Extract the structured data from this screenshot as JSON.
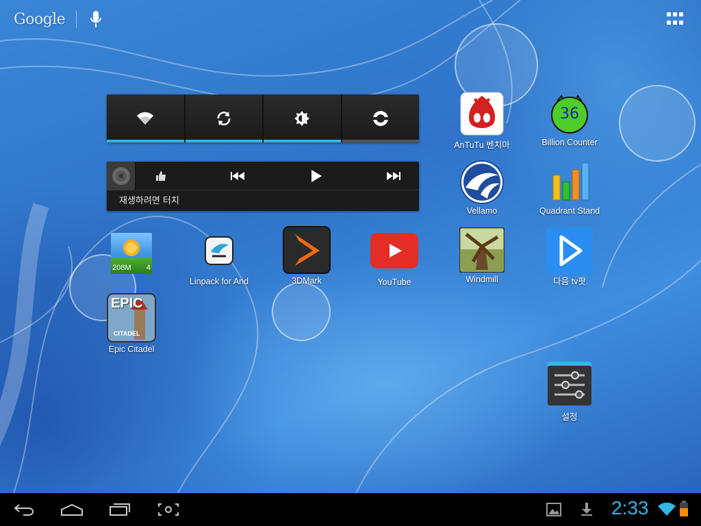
{
  "search": {
    "logo_text": "Google",
    "icons": [
      "mic-icon"
    ]
  },
  "launcher": {
    "all_apps_icon": "all-apps-grid-icon"
  },
  "power_widget": {
    "buttons": [
      {
        "name": "wifi",
        "icon": "wifi-icon",
        "state": "on"
      },
      {
        "name": "sync",
        "icon": "sync-icon",
        "state": "on"
      },
      {
        "name": "brightness",
        "icon": "brightness-icon",
        "state": "on"
      },
      {
        "name": "rotation",
        "icon": "rotation-icon",
        "state": "off"
      }
    ]
  },
  "music_widget": {
    "status_text": "재생하려면 터치",
    "controls": [
      "thumbs-up-icon",
      "previous-icon",
      "play-icon",
      "next-icon"
    ]
  },
  "apps": {
    "antutu": "AnTuTu 벤치마",
    "billion_counter": "Billion Counter",
    "billion_counter_badge": "36",
    "vellamo": "Vellamo",
    "quadrant": "Quadrant Stand",
    "task_widget_left": "208M",
    "task_widget_right": "4",
    "linpack": "Linpack for And",
    "threedmark": "3DMark",
    "youtube": "YouTube",
    "windmill": "Windmill",
    "daum_tv": "다음 tv팟",
    "epic_citadel": "Epic Citadel",
    "epic_text_top": "EPIC",
    "epic_text_bottom": "CITADEL",
    "settings": "설정"
  },
  "status_bar": {
    "time": "2:33"
  },
  "colors": {
    "accent": "#33b5e5",
    "battery": "#ff8a00"
  }
}
